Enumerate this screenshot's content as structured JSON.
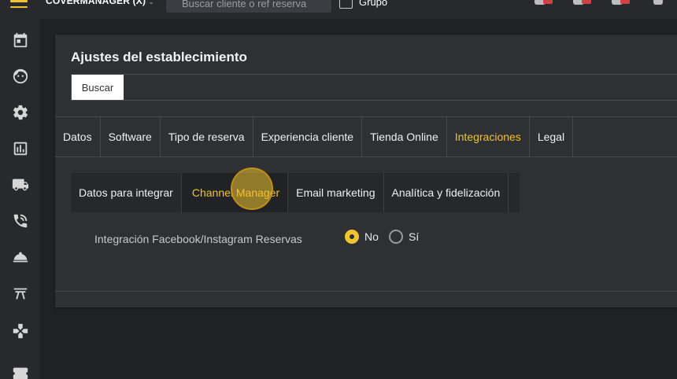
{
  "topbar": {
    "brand": "COVERMANAGER (X)",
    "brand_caret": "⌄",
    "search_placeholder": "Buscar cliente o ref reserva",
    "group_label": "Grupo"
  },
  "sidebar": {
    "items": [
      {
        "icon": "calendar-icon"
      },
      {
        "icon": "face-icon"
      },
      {
        "icon": "gear-icon"
      },
      {
        "icon": "bar-chart-icon"
      },
      {
        "icon": "truck-icon"
      },
      {
        "icon": "phone-icon"
      },
      {
        "icon": "room-service-icon"
      },
      {
        "icon": "table-icon"
      },
      {
        "icon": "gamepad-icon"
      },
      {
        "icon": "ticket-icon"
      }
    ]
  },
  "card": {
    "title": "Ajustes del establecimiento",
    "search_button": "Buscar",
    "main_tabs": [
      {
        "label": "Datos",
        "active": false
      },
      {
        "label": "Software",
        "active": false
      },
      {
        "label": "Tipo de reserva",
        "active": false
      },
      {
        "label": "Experiencia cliente",
        "active": false
      },
      {
        "label": "Tienda Online",
        "active": false
      },
      {
        "label": "Integraciones",
        "active": true
      },
      {
        "label": "Legal",
        "active": false
      }
    ],
    "sub_tabs": [
      {
        "label": "Datos para integrar",
        "active": false
      },
      {
        "label": "Channel Manager",
        "active": true
      },
      {
        "label": "Email marketing",
        "active": false
      },
      {
        "label": "Analítica y fidelización",
        "active": false
      }
    ],
    "setting": {
      "label": "Integración Facebook/Instagram Reservas",
      "options": [
        {
          "label": "No",
          "checked": true
        },
        {
          "label": "Sí",
          "checked": false
        }
      ]
    }
  },
  "colors": {
    "accent": "#f1c232",
    "background": "#1f2225",
    "card": "#2e3033",
    "sidebar": "#27292c"
  }
}
